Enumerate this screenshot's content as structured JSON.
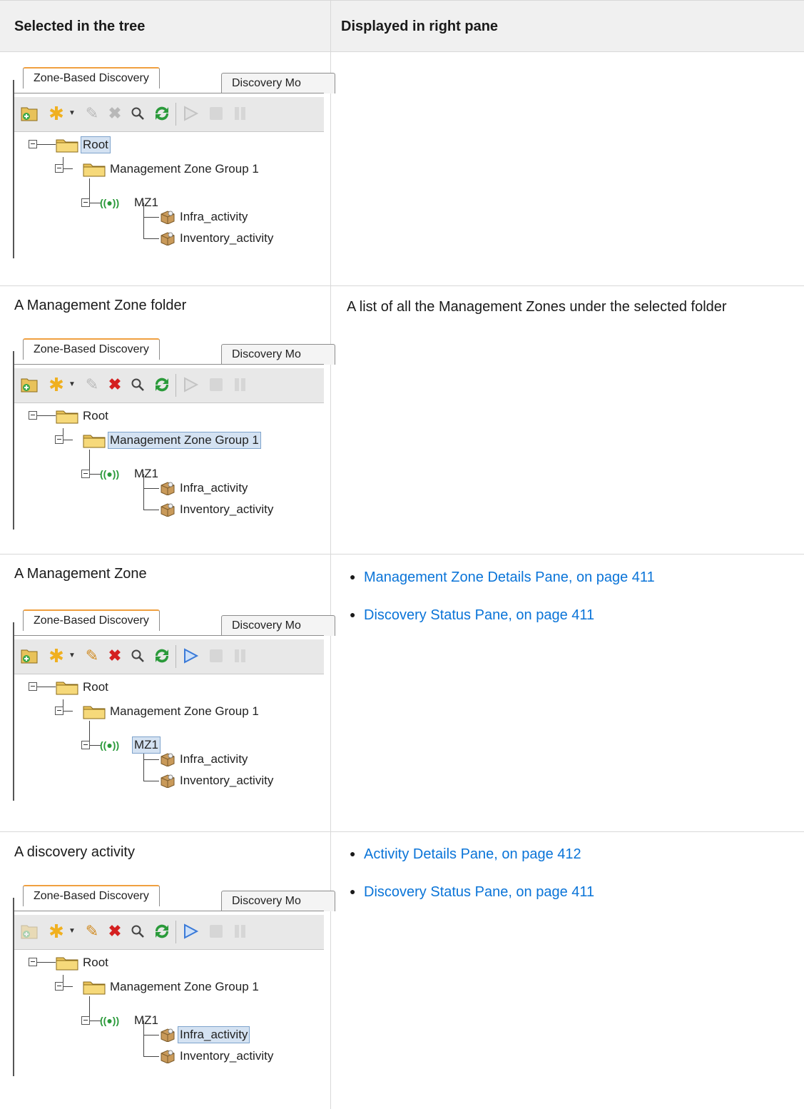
{
  "table": {
    "headers": [
      "Selected in the tree",
      "Displayed in right pane"
    ],
    "rows": [
      {
        "selected_text": "",
        "right_text": "",
        "links": [],
        "screenshot": {
          "active_tab": "Zone-Based Discovery",
          "inactive_tab": "Discovery Mo",
          "selected_node": "root",
          "delete_enabled": false,
          "edit_enabled": false,
          "run_enabled": false,
          "new_folder_enabled": true,
          "tree": {
            "root": "Root",
            "group": "Management Zone Group 1",
            "zone": "MZ1",
            "activity1": "Infra_activity",
            "activity2": "Inventory_activity"
          }
        }
      },
      {
        "selected_text": "A Management Zone folder",
        "right_text": "A list of all the Management Zones under the selected folder",
        "links": [],
        "screenshot": {
          "active_tab": "Zone-Based Discovery",
          "inactive_tab": "Discovery Mo",
          "selected_node": "group",
          "delete_enabled": true,
          "edit_enabled": false,
          "run_enabled": false,
          "new_folder_enabled": true,
          "tree": {
            "root": "Root",
            "group": "Management Zone Group 1",
            "zone": "MZ1",
            "activity1": "Infra_activity",
            "activity2": "Inventory_activity"
          }
        }
      },
      {
        "selected_text": "A Management Zone",
        "right_text": "",
        "links": [
          "Management Zone Details Pane, on page 411",
          "Discovery Status Pane, on page 411"
        ],
        "screenshot": {
          "active_tab": "Zone-Based Discovery",
          "inactive_tab": "Discovery Mo",
          "selected_node": "zone",
          "delete_enabled": true,
          "edit_enabled": true,
          "run_enabled": true,
          "new_folder_enabled": true,
          "tree": {
            "root": "Root",
            "group": "Management Zone Group 1",
            "zone": "MZ1",
            "activity1": "Infra_activity",
            "activity2": "Inventory_activity"
          }
        }
      },
      {
        "selected_text": "A discovery activity",
        "right_text": "",
        "links": [
          "Activity Details Pane, on page 412",
          "Discovery Status Pane, on page 411"
        ],
        "screenshot": {
          "active_tab": "Zone-Based Discovery",
          "inactive_tab": "Discovery Mo",
          "selected_node": "activity1",
          "delete_enabled": true,
          "edit_enabled": true,
          "run_enabled": true,
          "new_folder_enabled": false,
          "tree": {
            "root": "Root",
            "group": "Management Zone Group 1",
            "zone": "MZ1",
            "activity1": "Infra_activity",
            "activity2": "Inventory_activity"
          }
        }
      }
    ]
  },
  "colors": {
    "link": "#0a74d8",
    "header_bg": "#f0f0f0",
    "selection": "#d4e2f2",
    "tab_accent": "#f0a040",
    "delete_red": "#d42020",
    "refresh_green": "#2a9a3a",
    "run_blue": "#3a7ad8"
  },
  "icons": [
    "new-folder-icon",
    "new-item-icon",
    "edit-pencil-icon",
    "delete-x-icon",
    "search-icon",
    "refresh-icon",
    "run-icon",
    "stop-icon",
    "pause-icon",
    "folder-icon",
    "zone-signal-icon",
    "package-box-icon",
    "collapse-icon"
  ]
}
